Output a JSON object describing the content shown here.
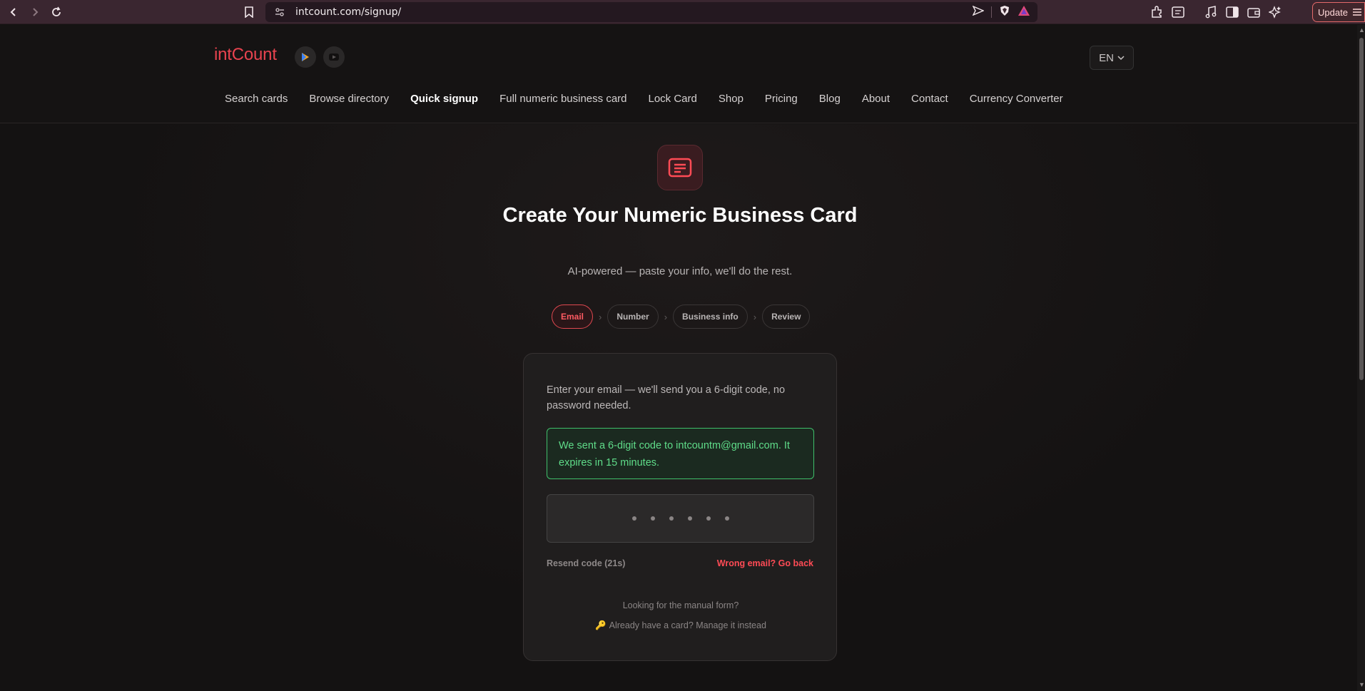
{
  "browser": {
    "url": "intcount.com/signup/",
    "update_label": "Update"
  },
  "site": {
    "logo": "intCount",
    "language": "EN",
    "nav": [
      {
        "label": "Search cards"
      },
      {
        "label": "Browse directory"
      },
      {
        "label": "Quick signup",
        "active": true
      },
      {
        "label": "Full numeric business card"
      },
      {
        "label": "Lock Card"
      },
      {
        "label": "Shop"
      },
      {
        "label": "Pricing"
      },
      {
        "label": "Blog"
      },
      {
        "label": "About"
      },
      {
        "label": "Contact"
      },
      {
        "label": "Currency Converter"
      }
    ]
  },
  "hero": {
    "title": "Create Your Numeric Business Card",
    "subtitle": "AI-powered — paste your info, we'll do the rest."
  },
  "steps": [
    {
      "label": "Email",
      "active": true
    },
    {
      "label": "Number"
    },
    {
      "label": "Business info"
    },
    {
      "label": "Review"
    }
  ],
  "card": {
    "intro": "Enter your email — we'll send you a 6-digit code, no password needed.",
    "notice": "We sent a 6-digit code to intcountm@gmail.com. It expires in 15 minutes.",
    "code_placeholder": "••••••",
    "resend": "Resend code (21s)",
    "go_back": "Wrong email? Go back",
    "manual_link": "Looking for the manual form?",
    "manage_link": "Already have a card? Manage it instead"
  },
  "colors": {
    "accent": "#e8434f",
    "success": "#5fdc89",
    "background": "#141212"
  }
}
